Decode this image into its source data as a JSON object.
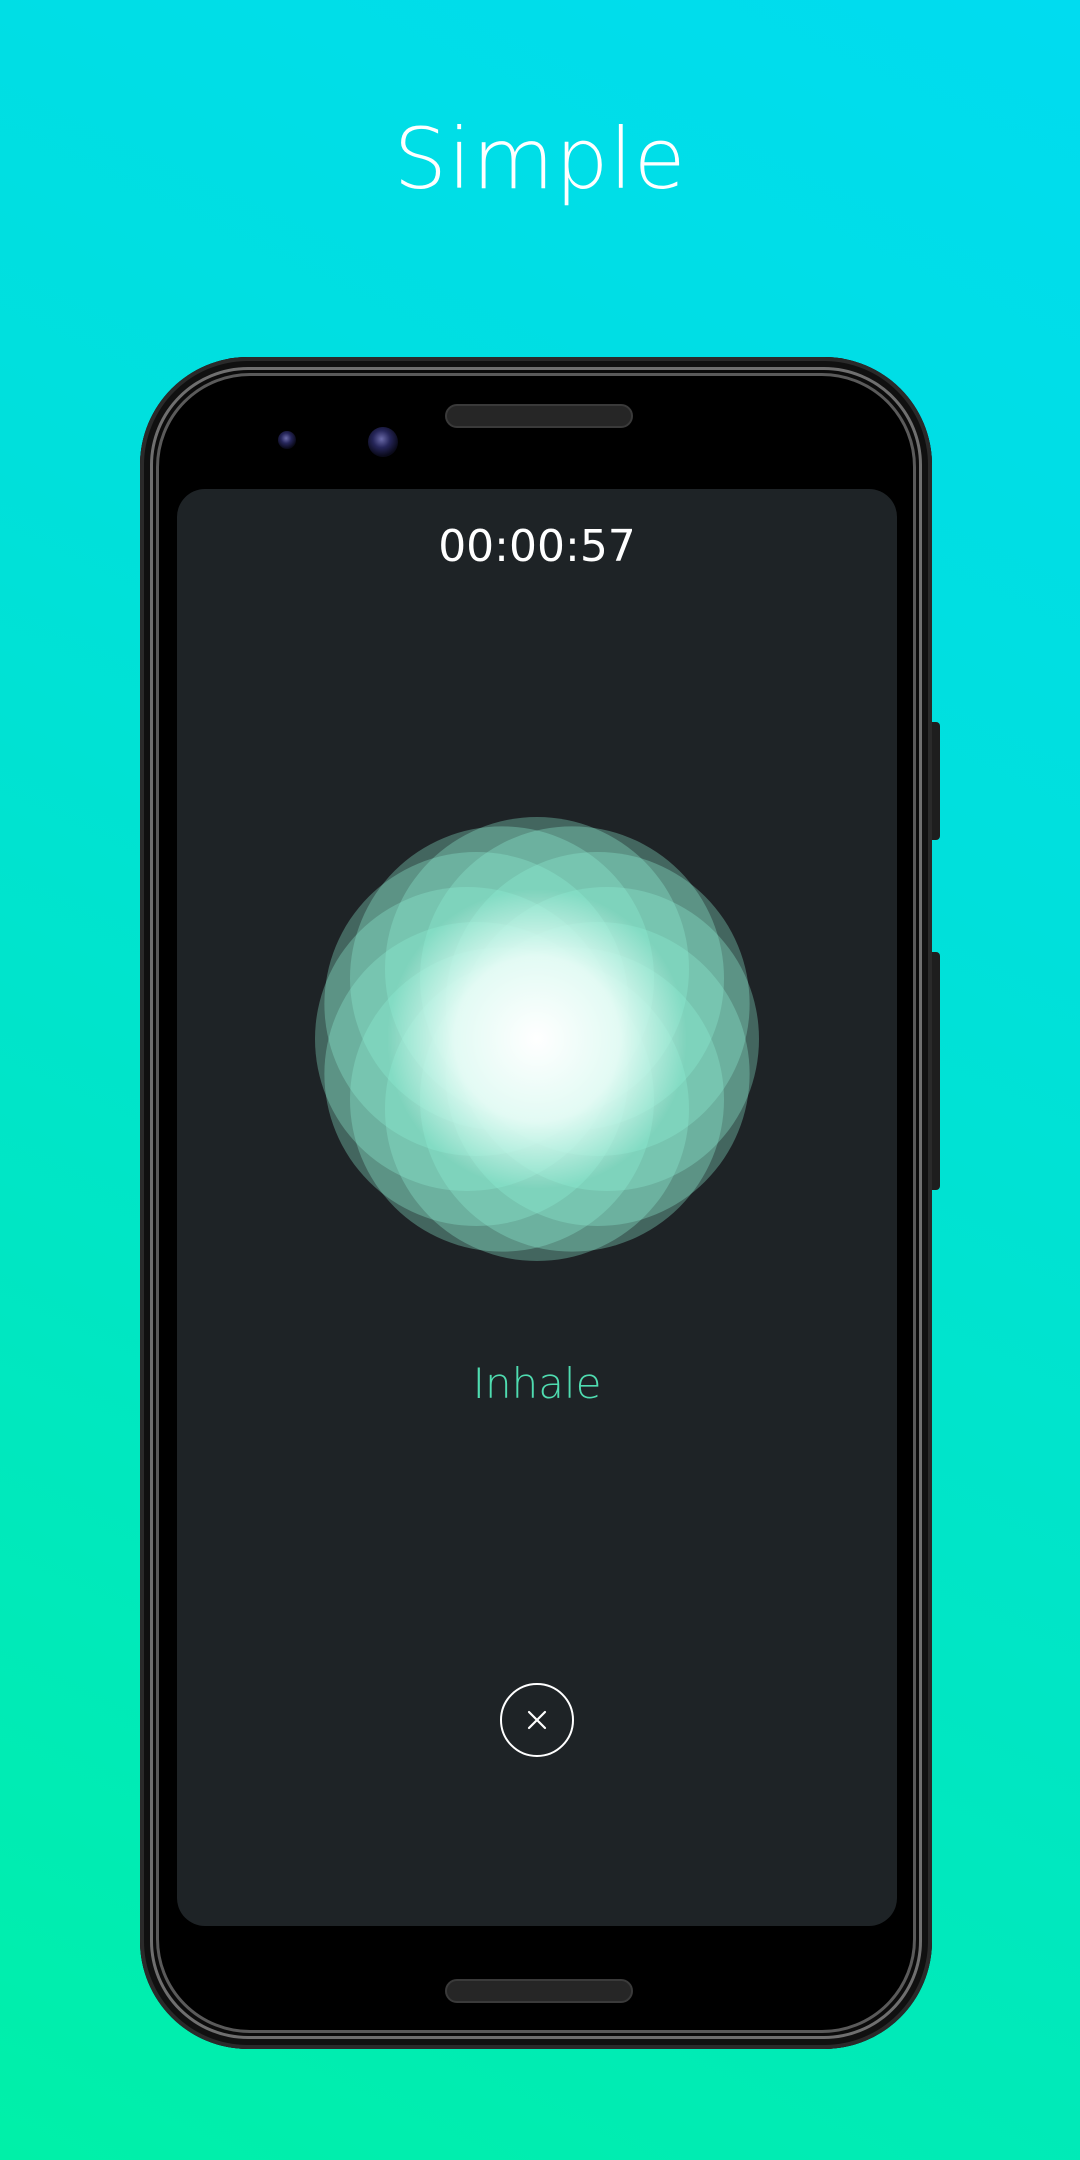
{
  "promo": {
    "headline": "Simple"
  },
  "session": {
    "timer": "00:00:57",
    "phase": "Inhale"
  },
  "controls": {
    "close_icon": "close-icon"
  },
  "colors": {
    "background_top": "#00dcf0",
    "background_bottom": "#00f0a8",
    "screen": "#1e2326",
    "phase_text": "#4fdcb0",
    "orb_petal": "#8ef0d6"
  }
}
